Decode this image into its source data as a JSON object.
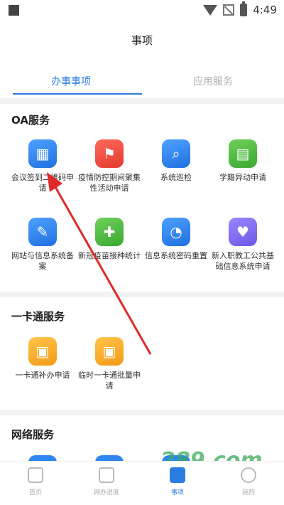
{
  "status_bar": {
    "time": "4:49",
    "icons": [
      "square-icon",
      "wifi-icon",
      "no-signal-icon",
      "battery-icon"
    ]
  },
  "header": {
    "title": "事项"
  },
  "tabs": [
    {
      "label": "办事事项",
      "active": true
    },
    {
      "label": "应用服务",
      "active": false
    }
  ],
  "sections": {
    "oa": {
      "title": "OA服务",
      "items": [
        {
          "label": "会议签到二维码申请",
          "icon": "qr-code-icon",
          "color": "#2f86f0"
        },
        {
          "label": "疫情防控期间聚集性活动申请",
          "icon": "flag-icon",
          "color": "#e5443a"
        },
        {
          "label": "系统巡检",
          "icon": "search-icon",
          "color": "#2f86f0"
        },
        {
          "label": "学籍异动申请",
          "icon": "contacts-icon",
          "color": "#43b03a"
        },
        {
          "label": "网站与信息系统备案",
          "icon": "document-icon",
          "color": "#2f86f0"
        },
        {
          "label": "新冠疫苗接种统计",
          "icon": "syringe-icon",
          "color": "#43b03a"
        },
        {
          "label": "信息系统密码重置",
          "icon": "unlock-icon",
          "color": "#2f86f0"
        },
        {
          "label": "新入职教工公共基础信息系统申请",
          "icon": "hand-icon",
          "color": "#7b66f0"
        }
      ]
    },
    "card": {
      "title": "一卡通服务",
      "items": [
        {
          "label": "一卡通补办申请",
          "icon": "id-card-icon",
          "color": "#f5a623"
        },
        {
          "label": "临时一卡通批量申请",
          "icon": "id-card-icon",
          "color": "#f5a623"
        }
      ]
    },
    "network": {
      "title": "网络服务"
    }
  },
  "bottom_nav": [
    {
      "label": "首页",
      "active": false
    },
    {
      "label": "网办进度",
      "active": false
    },
    {
      "label": "事项",
      "active": true
    },
    {
      "label": "我的",
      "active": false
    }
  ],
  "watermark": {
    "text": "289.com"
  },
  "colors": {
    "accent": "#2a7de1",
    "annotation_arrow": "#e02a2a"
  }
}
